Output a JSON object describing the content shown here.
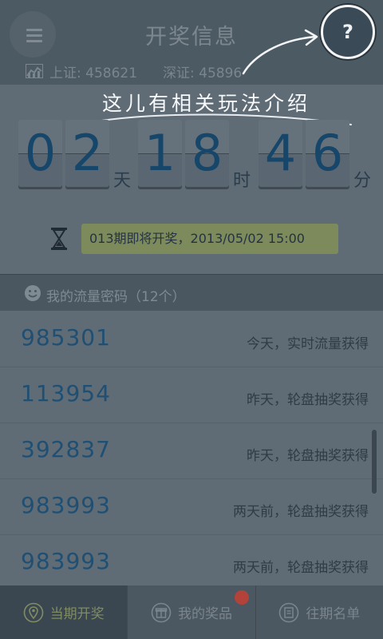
{
  "header": {
    "title": "开奖信息",
    "help_label": "?",
    "index_sh": "上证: 458621",
    "index_sz": "深证: 45896"
  },
  "hint": {
    "text": "这儿有相关玩法介绍"
  },
  "countdown": {
    "days": [
      "0",
      "2"
    ],
    "days_unit": "天",
    "hours": [
      "1",
      "8"
    ],
    "hours_unit": "时",
    "minutes": [
      "4",
      "6"
    ],
    "minutes_unit": "分"
  },
  "draw_info": {
    "text": "013期即将开奖，2013/05/02  15:00"
  },
  "section": {
    "title": "我的流量密码（12个）"
  },
  "codes": [
    {
      "code": "985301",
      "note": "今天，实时流量获得"
    },
    {
      "code": "113954",
      "note": "昨天，轮盘抽奖获得"
    },
    {
      "code": "392837",
      "note": "昨天，轮盘抽奖获得"
    },
    {
      "code": "983993",
      "note": "两天前，轮盘抽奖获得"
    },
    {
      "code": "983993",
      "note": "两天前，轮盘抽奖获得"
    }
  ],
  "nav": {
    "current": "当期开奖",
    "prizes": "我的奖品",
    "history": "往期名单"
  },
  "colors": {
    "header_bg": "#4c5a64",
    "digit_text": "#16466a",
    "code_text": "#1f4f73",
    "draw_info_bg": "#7d8a5c",
    "badge": "#b3423a"
  }
}
